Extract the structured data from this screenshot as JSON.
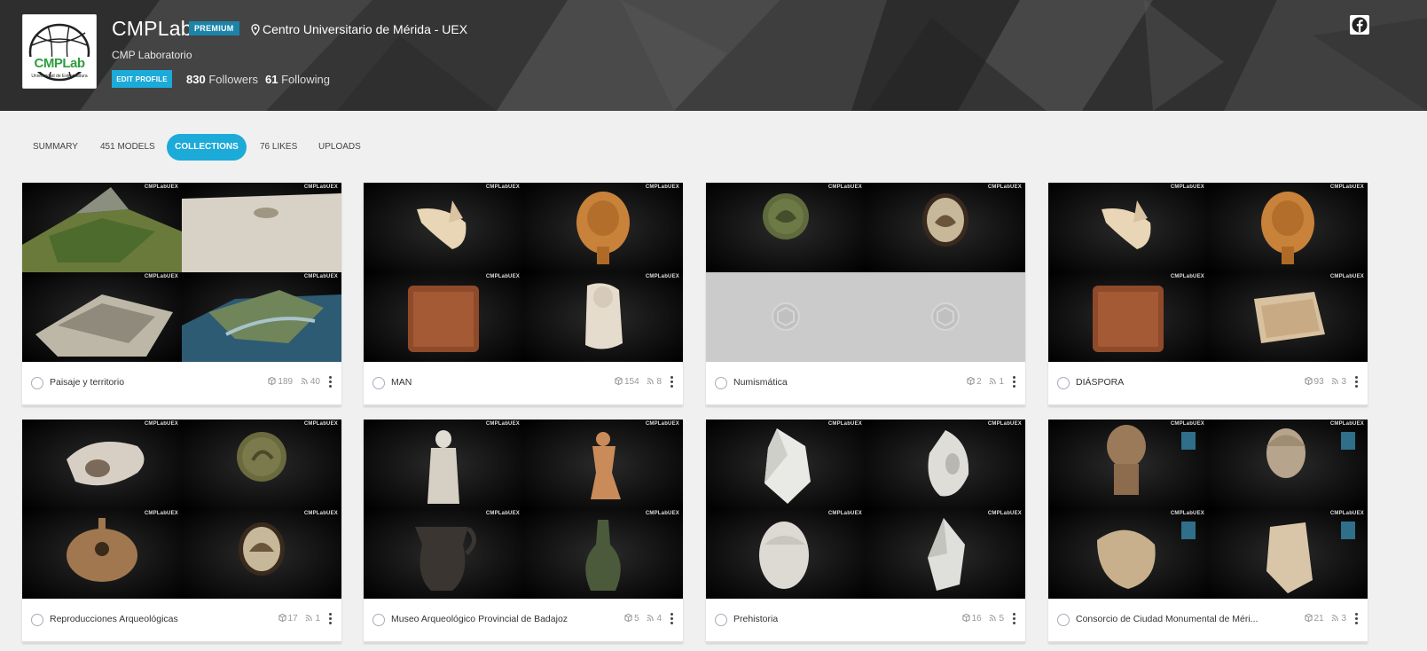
{
  "profile": {
    "avatar_text": "CMPLab",
    "avatar_sub": "Universidad de Extremadura",
    "username": "CMPLab",
    "badge": "PREMIUM",
    "location": "Centro Universitario de Mérida - UEX",
    "display_name": "CMP Laboratorio",
    "edit_label": "EDIT PROFILE",
    "followers_count": "830",
    "followers_label": "Followers",
    "following_count": "61",
    "following_label": "Following",
    "social_icon": "facebook-icon"
  },
  "tabs": [
    {
      "label": "SUMMARY",
      "active": false
    },
    {
      "label": "451 MODELS",
      "active": false
    },
    {
      "label": "COLLECTIONS",
      "active": true
    },
    {
      "label": "76 LIKES",
      "active": false
    },
    {
      "label": "UPLOADS",
      "active": false
    }
  ],
  "watermark": "CMPLabUEX",
  "collections": [
    {
      "name": "Paisaje y territorio",
      "models": "189",
      "followers": "40"
    },
    {
      "name": "MAN",
      "models": "154",
      "followers": "8"
    },
    {
      "name": "Numismática",
      "models": "2",
      "followers": "1"
    },
    {
      "name": "DIÁSPORA",
      "models": "93",
      "followers": "3"
    },
    {
      "name": "Reproducciones Arqueológicas",
      "models": "17",
      "followers": "1"
    },
    {
      "name": "Museo Arqueológico Provincial de Badajoz",
      "models": "5",
      "followers": "4"
    },
    {
      "name": "Prehistoria",
      "models": "16",
      "followers": "5"
    },
    {
      "name": "Consorcio de Ciudad Monumental de Méri...",
      "models": "21",
      "followers": "3"
    }
  ],
  "colors": {
    "accent": "#1caad9",
    "badge": "#1c84a8",
    "page_bg": "#f0f0f0",
    "logo_green": "#2e9e3e"
  }
}
